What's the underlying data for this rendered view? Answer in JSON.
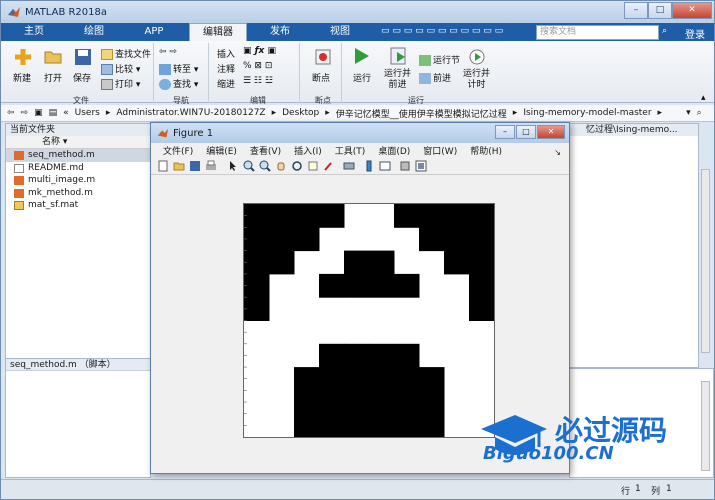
{
  "window": {
    "title": "MATLAB R2018a"
  },
  "window_controls": {
    "minimize": "–",
    "maximize": "□",
    "close": "✕"
  },
  "tabs": [
    {
      "label": "主页"
    },
    {
      "label": "绘图"
    },
    {
      "label": "APP"
    },
    {
      "label": "编辑器"
    },
    {
      "label": "发布"
    },
    {
      "label": "视图"
    }
  ],
  "search": {
    "placeholder": "搜索文档"
  },
  "login": "登录",
  "ribbon": {
    "new": "新建",
    "open": "打开",
    "save": "保存",
    "find_files": "查找文件",
    "compare": "比较",
    "print": "打印",
    "goto": "转至",
    "find": "查找",
    "insert": "插入",
    "comment": "注释",
    "indent": "缩进",
    "breakpoint": "断点",
    "run": "运行",
    "run_advance": "运行并\n前进",
    "run_section": "运行节",
    "advance": "前进",
    "run_time": "运行并\n计时",
    "groups": {
      "file": "文件",
      "navigate": "导航",
      "edit": "编辑",
      "breakpoints": "断点",
      "run": "运行"
    }
  },
  "address": {
    "path": [
      "Users",
      "Administrator.WIN7U-20180127Z",
      "Desktop",
      "伊辛记忆模型__使用伊辛模型模拟记忆过程",
      "Ising-memory-model-master"
    ]
  },
  "left_pane": {
    "title": "当前文件夹",
    "column": "名称",
    "files": [
      {
        "name": "seq_method.m",
        "type": "m"
      },
      {
        "name": "README.md",
        "type": "md"
      },
      {
        "name": "multi_image.m",
        "type": "m"
      },
      {
        "name": "mk_method.m",
        "type": "m"
      },
      {
        "name": "mat_sf.mat",
        "type": "mat"
      }
    ]
  },
  "detail": {
    "title": "seq_method.m （脚本）"
  },
  "right_pane": {
    "path_text": "忆过程\\Ising-memo..."
  },
  "status": {
    "row_label": "行",
    "row": "1",
    "col_label": "列",
    "col": "1"
  },
  "figure": {
    "title": "Figure 1",
    "menu": [
      "文件(F)",
      "编辑(E)",
      "查看(V)",
      "插入(I)",
      "工具(T)",
      "桌面(D)",
      "窗口(W)",
      "帮助(H)"
    ],
    "grid_cols": 10,
    "grid_rows": 10,
    "grid": [
      [
        1,
        1,
        1,
        1,
        0,
        0,
        1,
        1,
        1,
        1
      ],
      [
        1,
        1,
        1,
        0,
        0,
        0,
        0,
        1,
        1,
        1
      ],
      [
        1,
        1,
        0,
        0,
        1,
        1,
        0,
        0,
        1,
        1
      ],
      [
        1,
        0,
        0,
        1,
        1,
        1,
        1,
        0,
        0,
        1
      ],
      [
        1,
        0,
        0,
        0,
        0,
        0,
        0,
        0,
        0,
        1
      ],
      [
        0,
        0,
        0,
        0,
        0,
        0,
        0,
        0,
        0,
        0
      ],
      [
        0,
        0,
        0,
        1,
        1,
        1,
        1,
        0,
        0,
        0
      ],
      [
        0,
        0,
        1,
        1,
        1,
        1,
        1,
        1,
        0,
        0
      ],
      [
        0,
        0,
        1,
        1,
        1,
        1,
        1,
        1,
        0,
        0
      ],
      [
        0,
        0,
        1,
        1,
        1,
        1,
        1,
        1,
        0,
        0
      ]
    ]
  },
  "watermark": {
    "cn": "必过源码",
    "url": "Biguo100.CN"
  },
  "colors": {
    "tab_blue": "#1f5ea6",
    "watermark_blue": "#1b6fd1",
    "watermark_red": "#e02020"
  }
}
